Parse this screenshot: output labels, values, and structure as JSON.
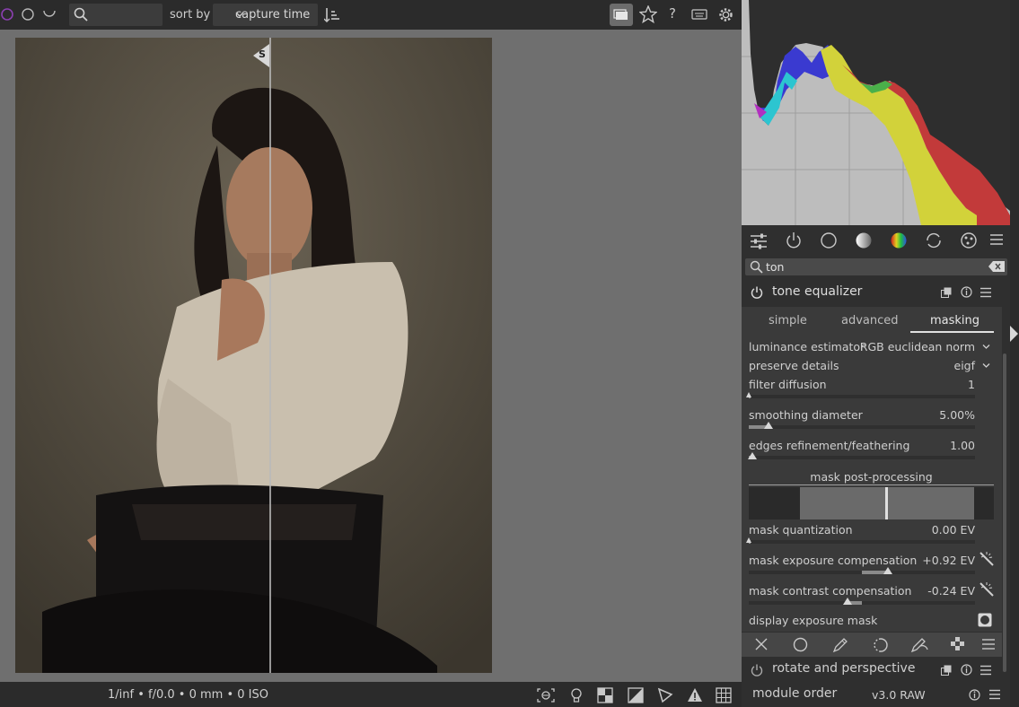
{
  "topbar": {
    "sort_label": "sort by",
    "sort_value": "capture time"
  },
  "bottombar": {
    "exif": "1/inf • f/0.0 • 0 mm • 0 ISO"
  },
  "module_search": {
    "value": "ton"
  },
  "module": {
    "title": "tone equalizer",
    "tabs": [
      "simple",
      "advanced",
      "masking"
    ],
    "active_tab": "masking",
    "section_title": "mask post-processing",
    "rows": {
      "luminance_estimator": {
        "label": "luminance estimator",
        "value": "RGB euclidean norm"
      },
      "preserve_details": {
        "label": "preserve details",
        "value": "eigf"
      },
      "filter_diffusion": {
        "label": "filter diffusion",
        "value": "1"
      },
      "smoothing_diameter": {
        "label": "smoothing diameter",
        "value": "5.00%"
      },
      "edges_refinement": {
        "label": "edges refinement/feathering",
        "value": "1.00"
      },
      "mask_quantization": {
        "label": "mask quantization",
        "value": "0.00 EV"
      },
      "mask_exposure": {
        "label": "mask exposure compensation",
        "value": "+0.92 EV"
      },
      "mask_contrast": {
        "label": "mask contrast compensation",
        "value": "-0.24 EV"
      },
      "display_mask": {
        "label": "display exposure mask"
      }
    }
  },
  "next_module": {
    "title": "rotate and perspective"
  },
  "footer": {
    "module_order_label": "module order",
    "module_order_value": "v3.0 RAW"
  },
  "split_marker": "S",
  "colors": {
    "accent_purple": "#8a3fb0",
    "panel": "#2f2f2f",
    "module_body": "#3a3a3a",
    "histogram_bg": "#bdbdbd"
  }
}
